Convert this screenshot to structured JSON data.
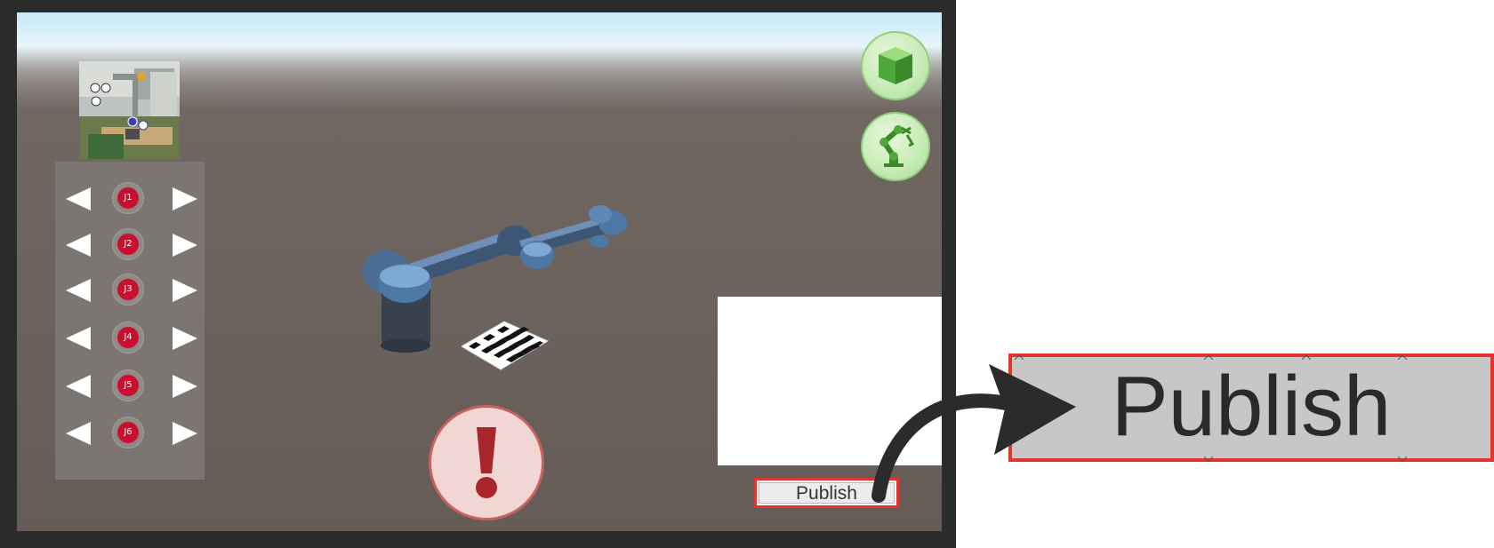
{
  "scene": {
    "joint_controls": [
      {
        "label": "J1"
      },
      {
        "label": "J2"
      },
      {
        "label": "J3"
      },
      {
        "label": "J4"
      },
      {
        "label": "J5"
      },
      {
        "label": "J6"
      }
    ],
    "top_right_buttons": [
      {
        "icon": "green-cube-icon"
      },
      {
        "icon": "robot-arm-icon"
      }
    ],
    "alert_button": {
      "icon": "exclamation-icon"
    },
    "publish_button": {
      "label": "Publish"
    }
  },
  "zoom_callout": {
    "label": "Publish"
  },
  "colors": {
    "highlight": "#e3342f",
    "joint_badge": "#c8102e",
    "fab_green": "#4fa83a",
    "alert_red": "#a8262b",
    "robot_blue": "#4d6e94"
  }
}
